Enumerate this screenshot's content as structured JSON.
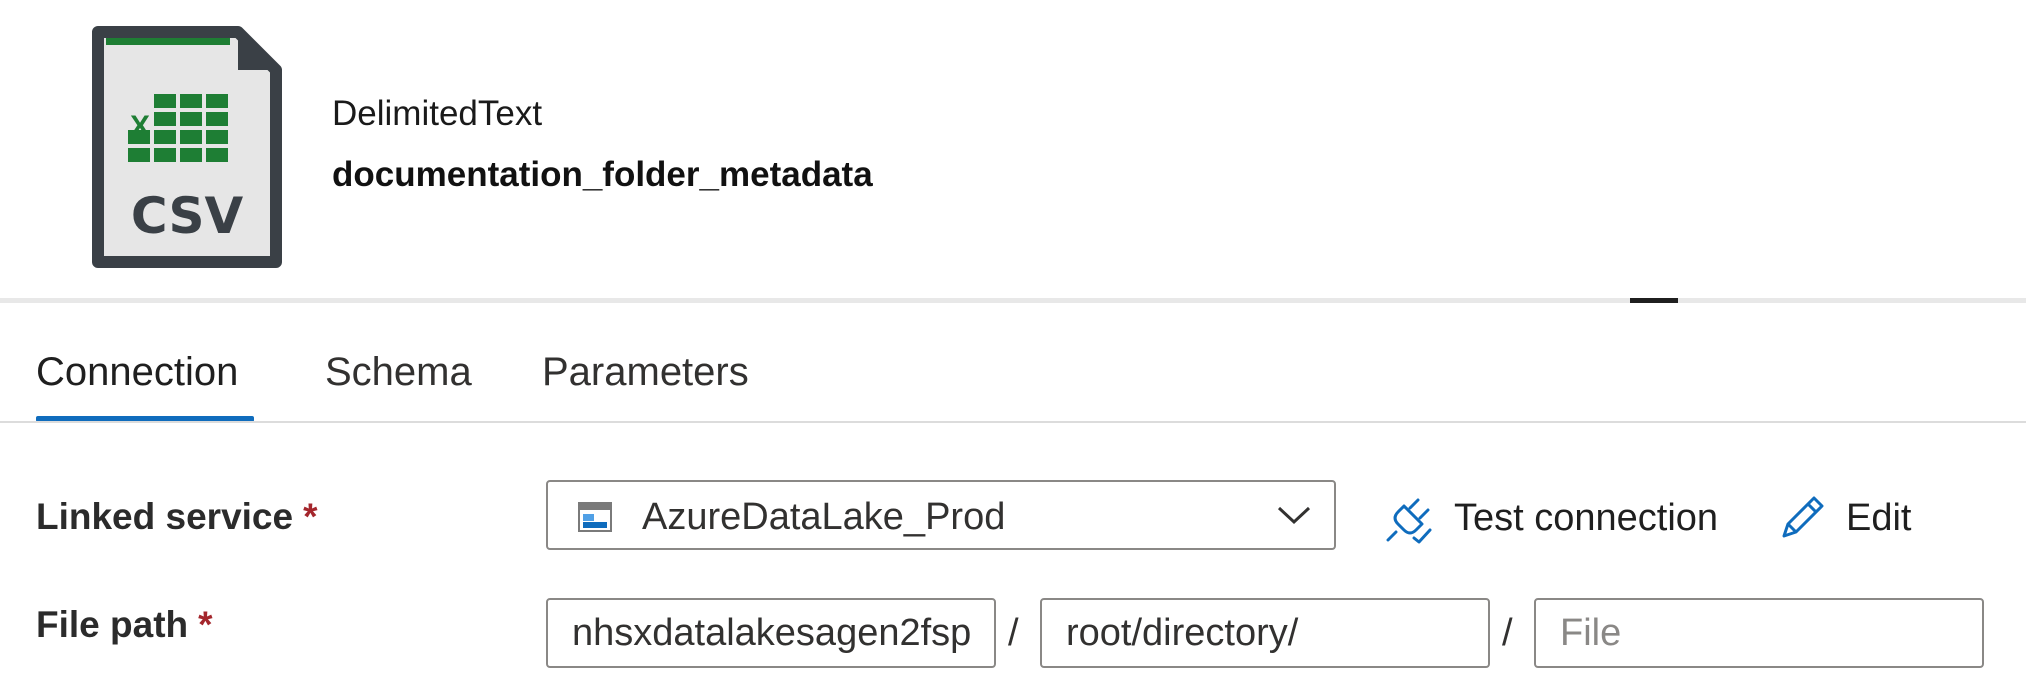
{
  "dataset": {
    "icon_text": "CSV",
    "icon_mark": "X",
    "type": "DelimitedText",
    "name": "documentation_folder_metadata"
  },
  "tabs": [
    {
      "label": "Connection",
      "active": true
    },
    {
      "label": "Schema",
      "active": false
    },
    {
      "label": "Parameters",
      "active": false
    }
  ],
  "linked_service": {
    "label": "Linked service",
    "required_mark": "*",
    "value": "AzureDataLake_Prod",
    "icon": "data-lake-storage-icon"
  },
  "actions": {
    "test_connection": "Test connection",
    "edit": "Edit"
  },
  "file_path": {
    "label": "File path",
    "required_mark": "*",
    "container": "nhsxdatalakesagen2fsp",
    "directory": "root/directory/",
    "file_placeholder": "File",
    "file_value": "",
    "separator": "/"
  },
  "colors": {
    "accent": "#0f6cbd",
    "required": "#a4262c",
    "csv_green": "#1e7e34",
    "csv_frame": "#3a4046"
  }
}
